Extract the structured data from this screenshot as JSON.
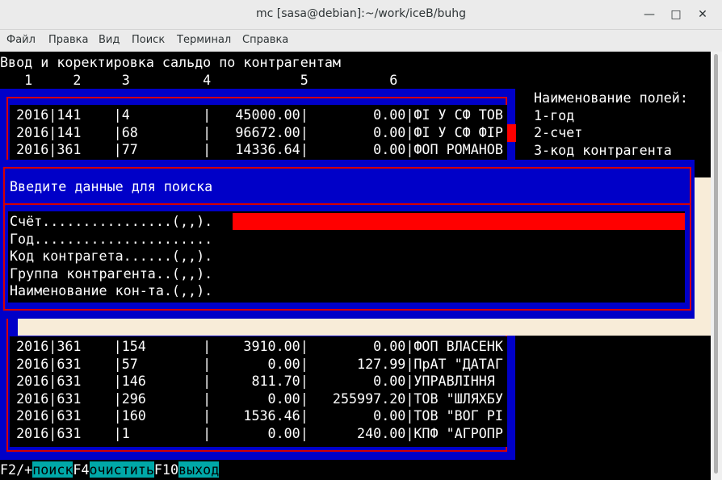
{
  "window": {
    "title": "mc [sasa@debian]:~/work/iceB/buhg"
  },
  "menu": [
    "Файл",
    "Правка",
    "Вид",
    "Поиск",
    "Терминал",
    "Справка"
  ],
  "screen": {
    "heading": "Ввод и коректировка сальдо по контрагентам",
    "col_numbers": "   1     2     3         4           5          6"
  },
  "table_rows_top": [
    {
      "year": "2016",
      "acct": "141",
      "code": "4",
      "debit": "45000.00",
      "credit": "0.00",
      "name": "ФІ У СФ ТОВ"
    },
    {
      "year": "2016",
      "acct": "141",
      "code": "68",
      "debit": "96672.00",
      "credit": "0.00",
      "name": "ФІ У СФ ФІР"
    },
    {
      "year": "2016",
      "acct": "361",
      "code": "77",
      "debit": "14336.64",
      "credit": "0.00",
      "name": "ФОП РОМАНОВ"
    }
  ],
  "table_rows_bottom": [
    {
      "year": "2016",
      "acct": "361",
      "code": "154",
      "debit": "3910.00",
      "credit": "0.00",
      "name": "ФОП ВЛАСЕНК"
    },
    {
      "year": "2016",
      "acct": "631",
      "code": "57",
      "debit": "0.00",
      "credit": "127.99",
      "name": "ПрАТ \"ДАТАГ"
    },
    {
      "year": "2016",
      "acct": "631",
      "code": "146",
      "debit": "811.70",
      "credit": "0.00",
      "name": "УПРАВЛІННЯ"
    },
    {
      "year": "2016",
      "acct": "631",
      "code": "296",
      "debit": "0.00",
      "credit": "255997.20",
      "name": "ТОВ \"ШЛЯХБУ"
    },
    {
      "year": "2016",
      "acct": "631",
      "code": "160",
      "debit": "1536.46",
      "credit": "0.00",
      "name": "ТОВ \"ВОГ РІ"
    },
    {
      "year": "2016",
      "acct": "631",
      "code": "1",
      "debit": "0.00",
      "credit": "240.00",
      "name": "КПФ \"АГРОПР"
    }
  ],
  "side_panel": [
    "Наименование полей:",
    "1-год",
    "2-счет",
    "3-код контрагента"
  ],
  "dialog": {
    "title": "Введите данные для поиска",
    "fields": [
      {
        "label": "Счёт................(,,).",
        "value": ""
      },
      {
        "label": "Год......................",
        "value": ""
      },
      {
        "label": "Код контрагета......(,,).",
        "value": ""
      },
      {
        "label": "Группа контрагента..(,,).",
        "value": ""
      },
      {
        "label": "Наименование кон-та.(,,).",
        "value": ""
      }
    ]
  },
  "fkeys": [
    {
      "key": "F2/+",
      "label": "поиск"
    },
    {
      "key": "F4",
      "label": "очистить"
    },
    {
      "key": "F10",
      "label": "выход"
    }
  ],
  "colors": {
    "panel_blue": "#0000c8",
    "frame_red": "#d40000",
    "field_red": "#ff0000",
    "fkey_cyan": "#00a8a8",
    "shadow_cream": "#f8ecd8"
  }
}
